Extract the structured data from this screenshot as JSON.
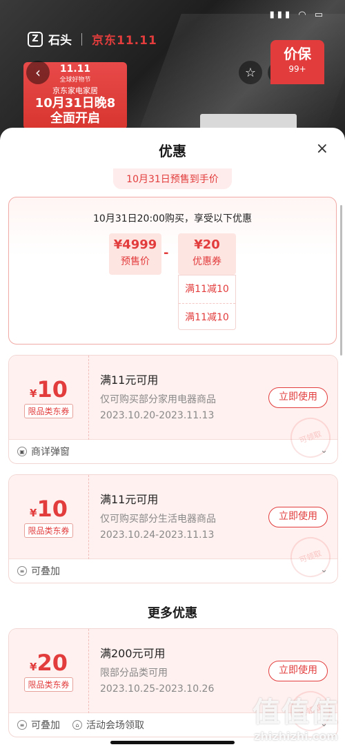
{
  "background": {
    "brand_logo": "Z",
    "brand_name": "石头",
    "jd_label": "京东11.11",
    "price_guard_title": "价保",
    "price_guard_count": "99+",
    "promo": {
      "top": "11.11",
      "sub": "全球好物节",
      "line": "京东家电家居",
      "big1": "10月31日晚8",
      "big2": "全面开启"
    }
  },
  "sheet": {
    "title": "优惠",
    "close": "×"
  },
  "presale": {
    "tab": "10月31日预售到手价",
    "headline": "10月31日20:00购买，享受以下优惠",
    "price_value": "¥4999",
    "price_label": "预售价",
    "minus": "-",
    "coupon_value": "¥20",
    "coupon_label": "优惠券",
    "coupon_items": [
      "满11减10",
      "满11减10"
    ]
  },
  "coupons": [
    {
      "symbol": "¥",
      "amount": "10",
      "tag": "限品类东券",
      "title": "满11元可用",
      "desc": "仅可购买部分家用电器商品",
      "date": "2023.10.20-2023.11.13",
      "button": "立即使用",
      "stamp": "可领取",
      "foot": [
        "商详弹窗"
      ]
    },
    {
      "symbol": "¥",
      "amount": "10",
      "tag": "限品类东券",
      "title": "满11元可用",
      "desc": "仅可购买部分生活电器商品",
      "date": "2023.10.24-2023.11.13",
      "button": "立即使用",
      "stamp": "可领取",
      "foot": [
        "可叠加"
      ]
    },
    {
      "symbol": "¥",
      "amount": "20",
      "tag": "限品类东券",
      "title": "满200元可用",
      "desc": "限部分品类可用",
      "date": "2023.10.25-2023.10.26",
      "button": "立即使用",
      "stamp": "可领取",
      "foot": [
        "可叠加",
        "活动会场领取"
      ]
    }
  ],
  "more_title": "更多优惠",
  "watermark": {
    "big": "值值值",
    "small": "zhizhizhi.com"
  },
  "colors": {
    "accent": "#e23c3c",
    "coupon_bg": "#fff1ef"
  }
}
